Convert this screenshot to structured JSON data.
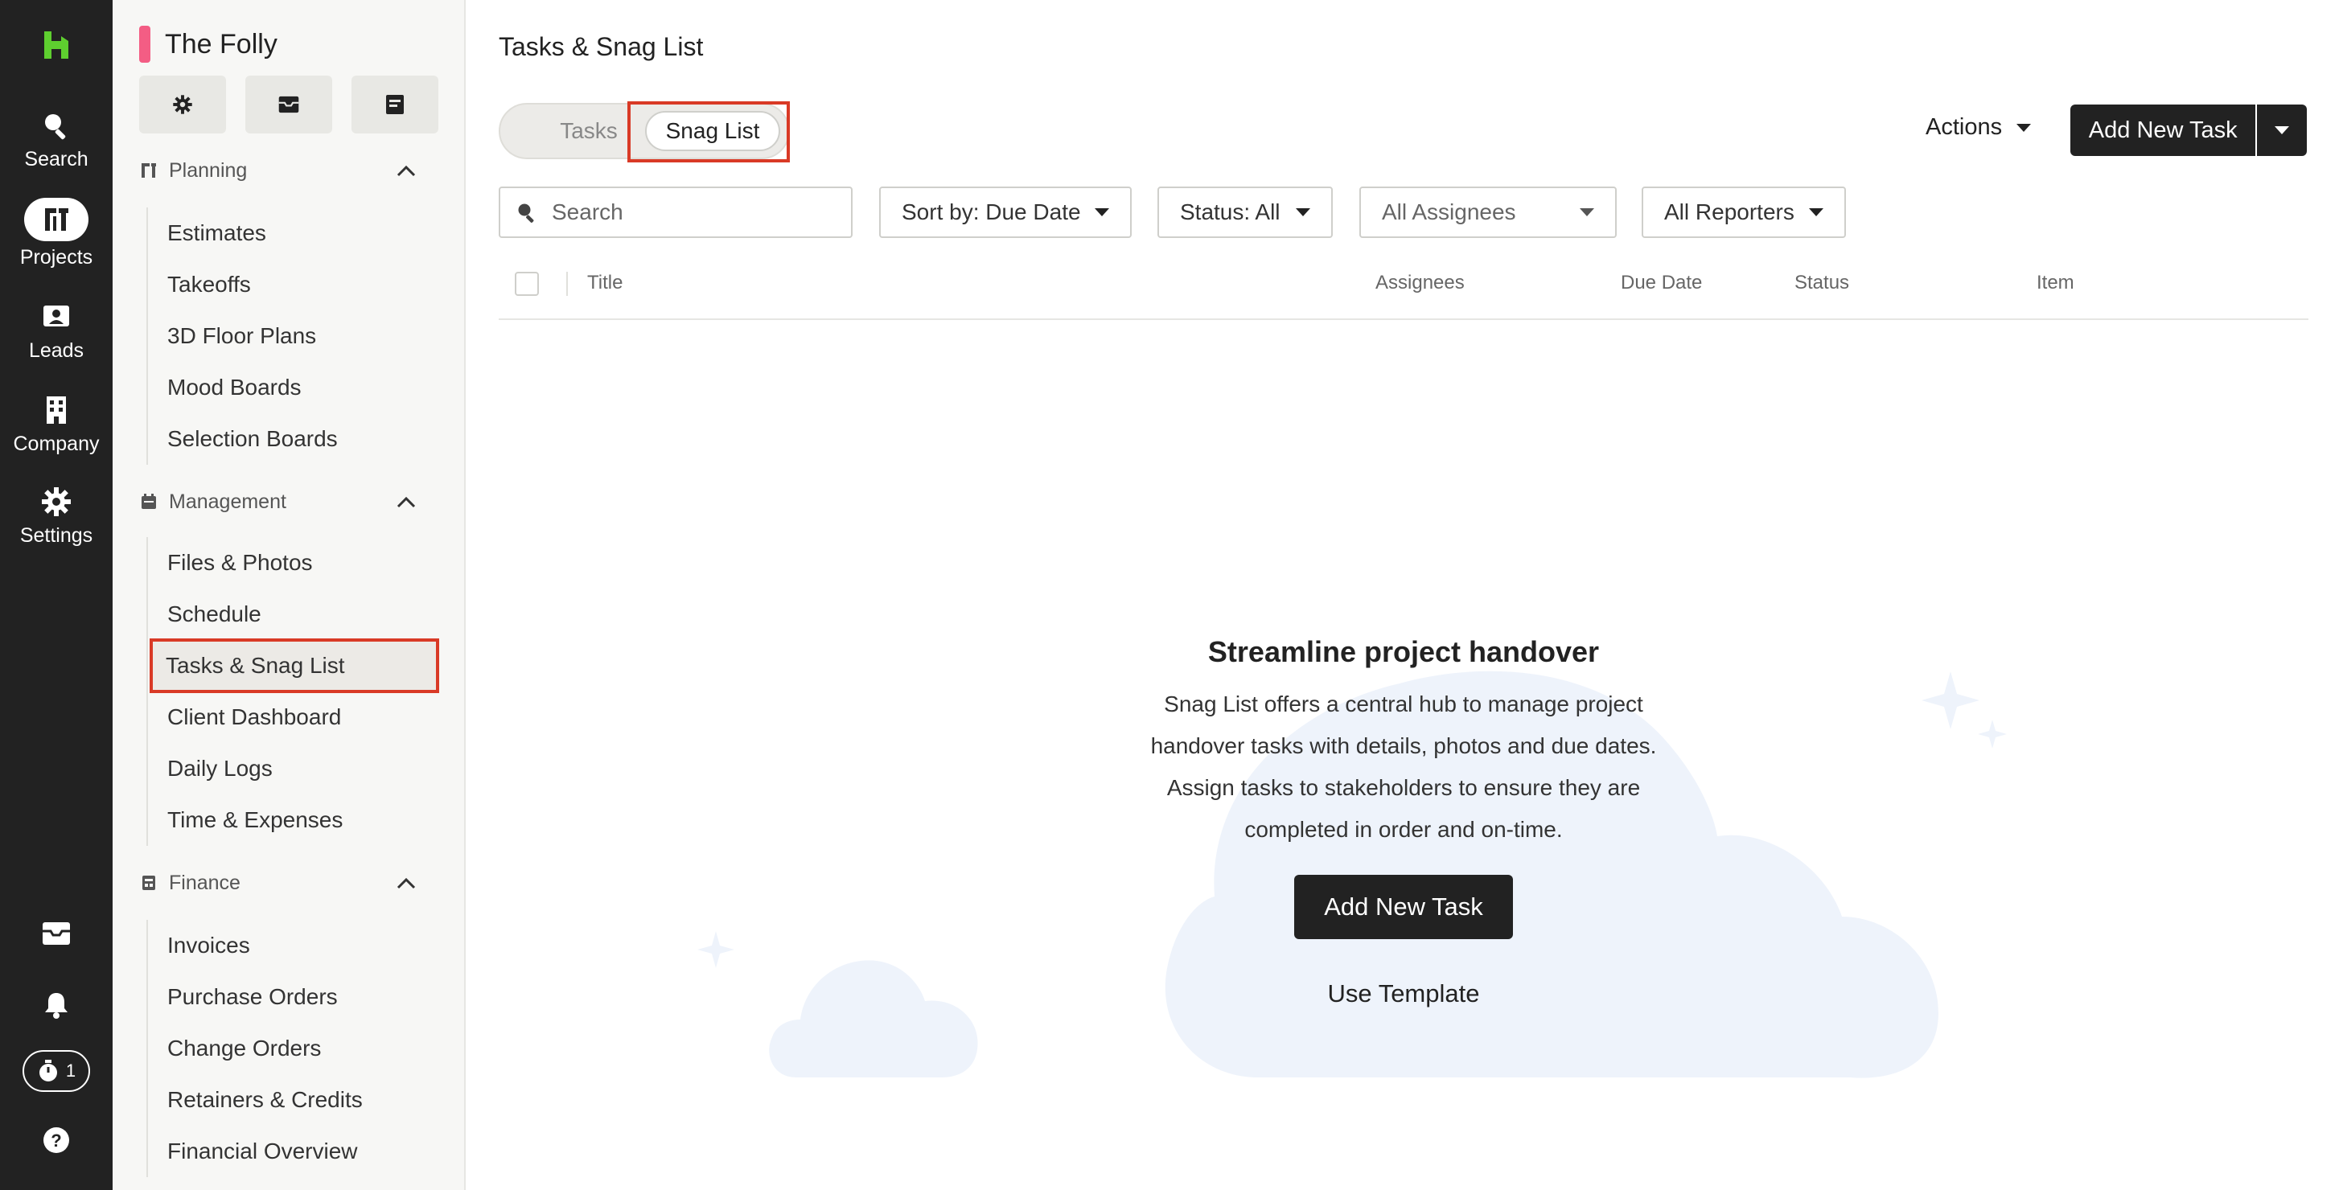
{
  "rail": {
    "items": [
      {
        "label": "Search",
        "icon": "search-icon"
      },
      {
        "label": "Projects",
        "icon": "projects-icon"
      },
      {
        "label": "Leads",
        "icon": "leads-icon"
      },
      {
        "label": "Company",
        "icon": "company-icon"
      },
      {
        "label": "Settings",
        "icon": "gear-icon"
      }
    ],
    "timer_count": "1",
    "logo_color": "#5ecf2f"
  },
  "sidebar": {
    "project_name": "The Folly",
    "project_color": "#f35d84",
    "sections": [
      {
        "title": "Planning",
        "items": [
          "Estimates",
          "Takeoffs",
          "3D Floor Plans",
          "Mood Boards",
          "Selection Boards"
        ]
      },
      {
        "title": "Management",
        "items": [
          "Files & Photos",
          "Schedule",
          "Tasks & Snag List",
          "Client Dashboard",
          "Daily Logs",
          "Time & Expenses"
        ]
      },
      {
        "title": "Finance",
        "items": [
          "Invoices",
          "Purchase Orders",
          "Change Orders",
          "Retainers & Credits",
          "Financial Overview"
        ]
      }
    ],
    "active_item": "Tasks & Snag List"
  },
  "main": {
    "title": "Tasks & Snag List",
    "tabs": [
      "Tasks",
      "Snag List"
    ],
    "active_tab": "Snag List",
    "actions_label": "Actions",
    "add_task_label": "Add New Task",
    "search_placeholder": "Search",
    "filters": {
      "sort": "Sort by: Due Date",
      "status": "Status: All",
      "assignees": "All Assignees",
      "reporters": "All Reporters"
    },
    "columns": [
      "Title",
      "Assignees",
      "Due Date",
      "Status",
      "Item"
    ],
    "empty_state": {
      "title": "Streamline project handover",
      "lines": [
        "Snag List offers a central hub to manage project",
        "handover tasks with details, photos and due dates.",
        "Assign tasks to stakeholders to ensure they are",
        "completed in order and on-time."
      ],
      "primary_button": "Add New Task",
      "secondary_link": "Use Template"
    }
  },
  "colors": {
    "accent_dark": "#222222",
    "highlight_red": "#d93a26",
    "cloud": "#eef3fb"
  }
}
